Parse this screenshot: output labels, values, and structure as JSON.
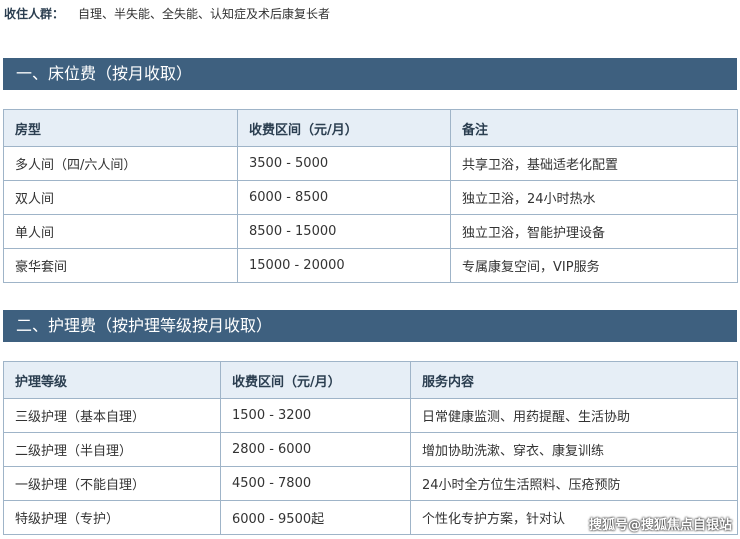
{
  "intro": {
    "label": "收住人群：",
    "value": "自理、半失能、全失能、认知症及术后康复长者"
  },
  "section1": {
    "title": "一、床位费（按月收取）",
    "headers": [
      "房型",
      "收费区间（元/月）",
      "备注"
    ],
    "rows": [
      [
        "多人间（四/六人间）",
        "3500 - 5000",
        "共享卫浴，基础适老化配置"
      ],
      [
        "双人间",
        "6000 - 8500",
        "独立卫浴，24小时热水"
      ],
      [
        "单人间",
        "8500 - 15000",
        "独立卫浴，智能护理设备"
      ],
      [
        "豪华套间",
        "15000 - 20000",
        "专属康复空间，VIP服务"
      ]
    ]
  },
  "section2": {
    "title": "二、护理费（按护理等级按月收取）",
    "headers": [
      "护理等级",
      "收费区间（元/月）",
      "服务内容"
    ],
    "rows": [
      [
        "三级护理（基本自理）",
        "1500 - 3200",
        "日常健康监测、用药提醒、生活协助"
      ],
      [
        "二级护理（半自理）",
        "2800 - 6000",
        "增加协助洗漱、穿衣、康复训练"
      ],
      [
        "一级护理（不能自理）",
        "4500 - 7800",
        "24小时全方位生活照料、压疮预防"
      ],
      [
        "特级护理（专护）",
        "6000 - 9500起",
        "个性化专护方案，针对认"
      ]
    ]
  },
  "watermark": "搜狐号@搜狐焦点自银站"
}
